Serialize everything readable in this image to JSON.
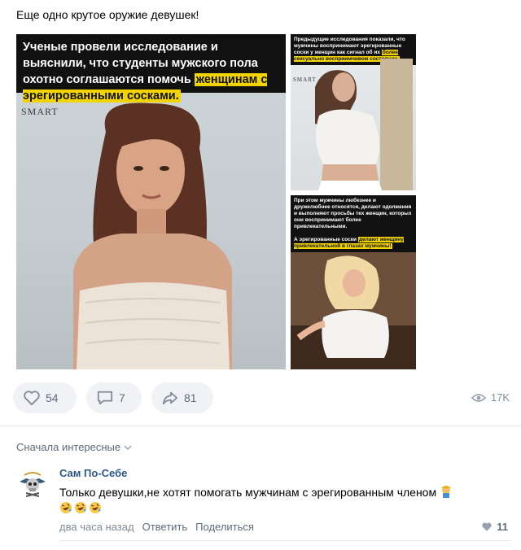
{
  "post": {
    "text": "Еще одно крутое оружие девушек!",
    "images": {
      "main": {
        "caption_before": "Ученые провели исследование и выяснили, что студенты мужского пола охотно соглашаются помочь ",
        "caption_highlight": "женщинам с эрегированными сосками.",
        "watermark": "SMART"
      },
      "top": {
        "caption_before": "Предыдущие исследования показали, что мужчины воспринимают эрегированные соски у женщин как сигнал об их ",
        "caption_highlight": "более сексуально восприимчивом состоянии.",
        "watermark": "SMART"
      },
      "bottom": {
        "caption_1": "При этом мужчины любезнее и дружелюбнее относятся, делают одолжения и выполняют просьбы тех женщин, которых они воспринимают более привлекательными.",
        "caption_2_before": "А эрегированные соски ",
        "caption_2_highlight": "делают женщину привлекательной в глазах мужчины!"
      }
    }
  },
  "actions": {
    "likes": "54",
    "comments": "7",
    "shares": "81",
    "views": "17K"
  },
  "comments_sort": "Сначала интересные",
  "comment": {
    "author": "Сам По-Себе",
    "text": "Только девушки,не хотят помогать мужчинам с эрегированным членом",
    "time": "два часа назад",
    "reply_label": "Ответить",
    "share_label": "Поделиться",
    "likes": "11"
  },
  "colors": {
    "link": "#2a5885",
    "muted": "#818c99",
    "pill_bg": "#f0f2f5",
    "highlight": "#f2d500"
  }
}
